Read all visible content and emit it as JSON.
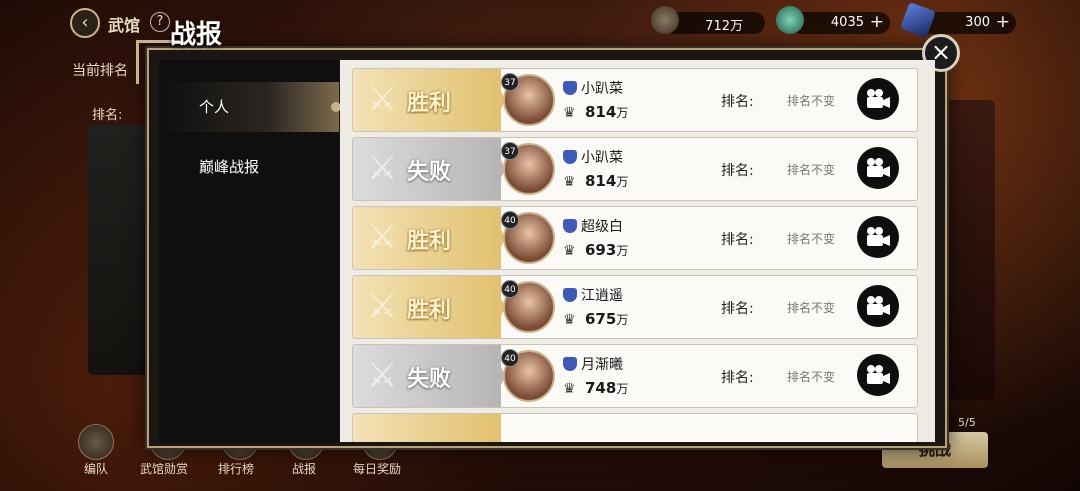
{
  "topbar": {
    "back_icon": "back-arrow-icon",
    "title": "武馆",
    "help": "?",
    "resources": [
      {
        "icon": "power-crest-icon",
        "value": "712万",
        "has_plus": false
      },
      {
        "icon": "jade-coin-icon",
        "value": "4035",
        "has_plus": true
      },
      {
        "icon": "crystal-icon",
        "value": "300",
        "has_plus": true
      }
    ]
  },
  "background": {
    "rank_strip": "当前排名",
    "rank_strip2": "排名:",
    "page_count": "5/5",
    "right_button": "挑战"
  },
  "bottom_nav": [
    {
      "label": "编队"
    },
    {
      "label": "武馆勋赏"
    },
    {
      "label": "排行榜"
    },
    {
      "label": "战报"
    },
    {
      "label": "每日奖励"
    }
  ],
  "modal": {
    "title": "战报",
    "close": "×",
    "tabs": [
      {
        "label": "个人",
        "active": true
      },
      {
        "label": "巅峰战报",
        "active": false
      }
    ],
    "rank_label": "排名:",
    "records": [
      {
        "result": "胜利",
        "outcome": "win",
        "level": "37",
        "name": "小趴菜",
        "power": "814",
        "power_unit": "万",
        "rank": "排名不变"
      },
      {
        "result": "失败",
        "outcome": "lose",
        "level": "37",
        "name": "小趴菜",
        "power": "814",
        "power_unit": "万",
        "rank": "排名不变"
      },
      {
        "result": "胜利",
        "outcome": "win",
        "level": "40",
        "name": "超级白",
        "power": "693",
        "power_unit": "万",
        "rank": "排名不变"
      },
      {
        "result": "胜利",
        "outcome": "win",
        "level": "40",
        "name": "江逍遥",
        "power": "675",
        "power_unit": "万",
        "rank": "排名不变"
      },
      {
        "result": "失败",
        "outcome": "lose",
        "level": "40",
        "name": "月渐曦",
        "power": "748",
        "power_unit": "万",
        "rank": "排名不变"
      }
    ]
  },
  "colors": {
    "win": "#e2c16f",
    "lose": "#b5b5b5",
    "gold_border": "#b7a27a"
  }
}
